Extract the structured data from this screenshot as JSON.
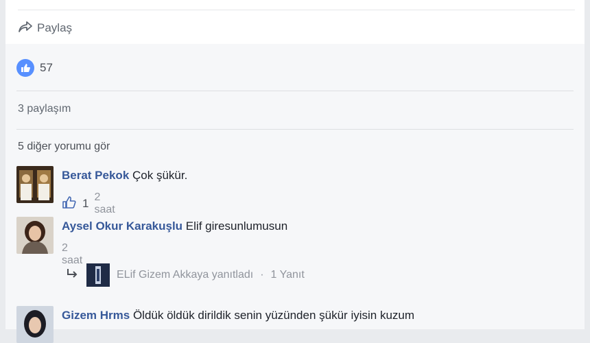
{
  "share_bar": {
    "share_label": "Paylaş"
  },
  "reactions": {
    "like_count": "57"
  },
  "shares": {
    "label": "3 paylaşım"
  },
  "comments_header": {
    "label": "5 diğer yorumu gör"
  },
  "comments": [
    {
      "author": "Berat Pekok",
      "text": "Çok şükür.",
      "like_count": "1",
      "time": "2 saat"
    },
    {
      "author": "Aysel Okur Karakuşlu",
      "text": "Elif giresunlumusun",
      "time": "2 saat"
    },
    {
      "author": "Gizem Hrms",
      "text": "Öldük öldük dirildik senin yüzünden şükür iyisin kuzum"
    }
  ],
  "reply_summary": {
    "text": "ELif Gizem Akkaya yanıtladı",
    "dot": "·",
    "count": "1 Yanıt"
  },
  "colors": {
    "link_blue": "#365899",
    "like_blue": "#5890ff",
    "background": "#f6f7f9"
  },
  "icons": [
    "share-arrow-icon",
    "like-icon",
    "thumbs-up-icon",
    "reply-arrow-icon"
  ]
}
